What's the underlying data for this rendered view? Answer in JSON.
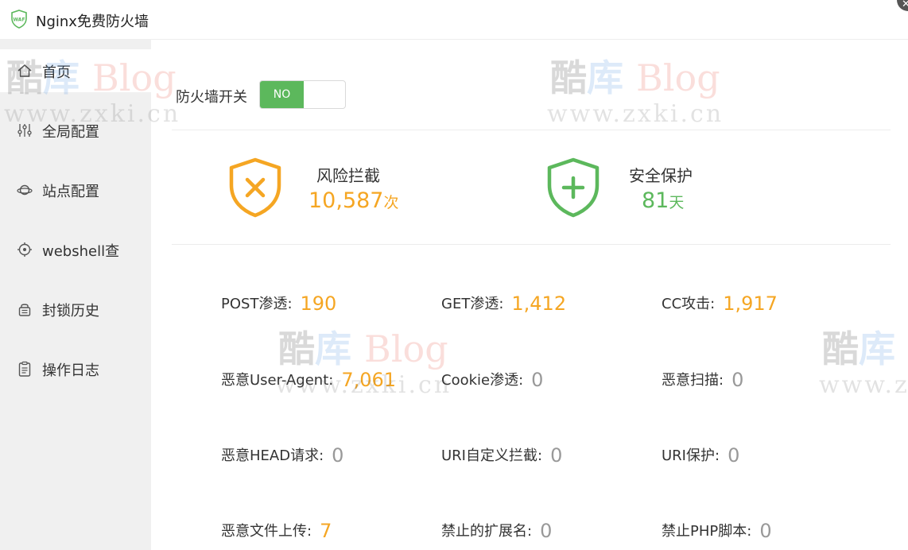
{
  "window": {
    "title": "Nginx免费防火墙",
    "logo_text": "WAF",
    "close_icon": "close-icon"
  },
  "sidebar": {
    "items": [
      {
        "label": "首页",
        "icon": "home-icon",
        "active": true
      },
      {
        "label": "全局配置",
        "icon": "sliders-icon",
        "active": false
      },
      {
        "label": "站点配置",
        "icon": "planet-icon",
        "active": false
      },
      {
        "label": "webshell查",
        "icon": "target-icon",
        "active": false
      },
      {
        "label": "封锁历史",
        "icon": "lock-history-icon",
        "active": false
      },
      {
        "label": "操作日志",
        "icon": "clipboard-icon",
        "active": false
      }
    ]
  },
  "firewall_switch": {
    "label": "防火墙开关",
    "state_text": "NO"
  },
  "stats": {
    "risk_block": {
      "title": "风险拦截",
      "value": "10,587",
      "unit": "次"
    },
    "protection": {
      "title": "安全保护",
      "value": "81",
      "unit": "天"
    }
  },
  "metrics": [
    {
      "label": "POST渗透:",
      "value": "190"
    },
    {
      "label": "GET渗透:",
      "value": "1,412"
    },
    {
      "label": "CC攻击:",
      "value": "1,917"
    },
    {
      "label": "恶意User-Agent:",
      "value": "7,061"
    },
    {
      "label": "Cookie渗透:",
      "value": "0"
    },
    {
      "label": "恶意扫描:",
      "value": "0"
    },
    {
      "label": "恶意HEAD请求:",
      "value": "0"
    },
    {
      "label": "URI自定义拦截:",
      "value": "0"
    },
    {
      "label": "URI保护:",
      "value": "0"
    },
    {
      "label": "恶意文件上传:",
      "value": "7"
    },
    {
      "label": "禁止的扩展名:",
      "value": "0"
    },
    {
      "label": "禁止PHP脚本:",
      "value": "0"
    }
  ],
  "watermark": {
    "cn1": "酷",
    "cn2": "库",
    "en": "Blog",
    "url": "www.zxki.cn"
  },
  "colors": {
    "accent_green": "#5cb85c",
    "accent_orange": "#f5a623",
    "zero_grey": "#999999",
    "sidebar_bg": "#f0f0f0"
  }
}
